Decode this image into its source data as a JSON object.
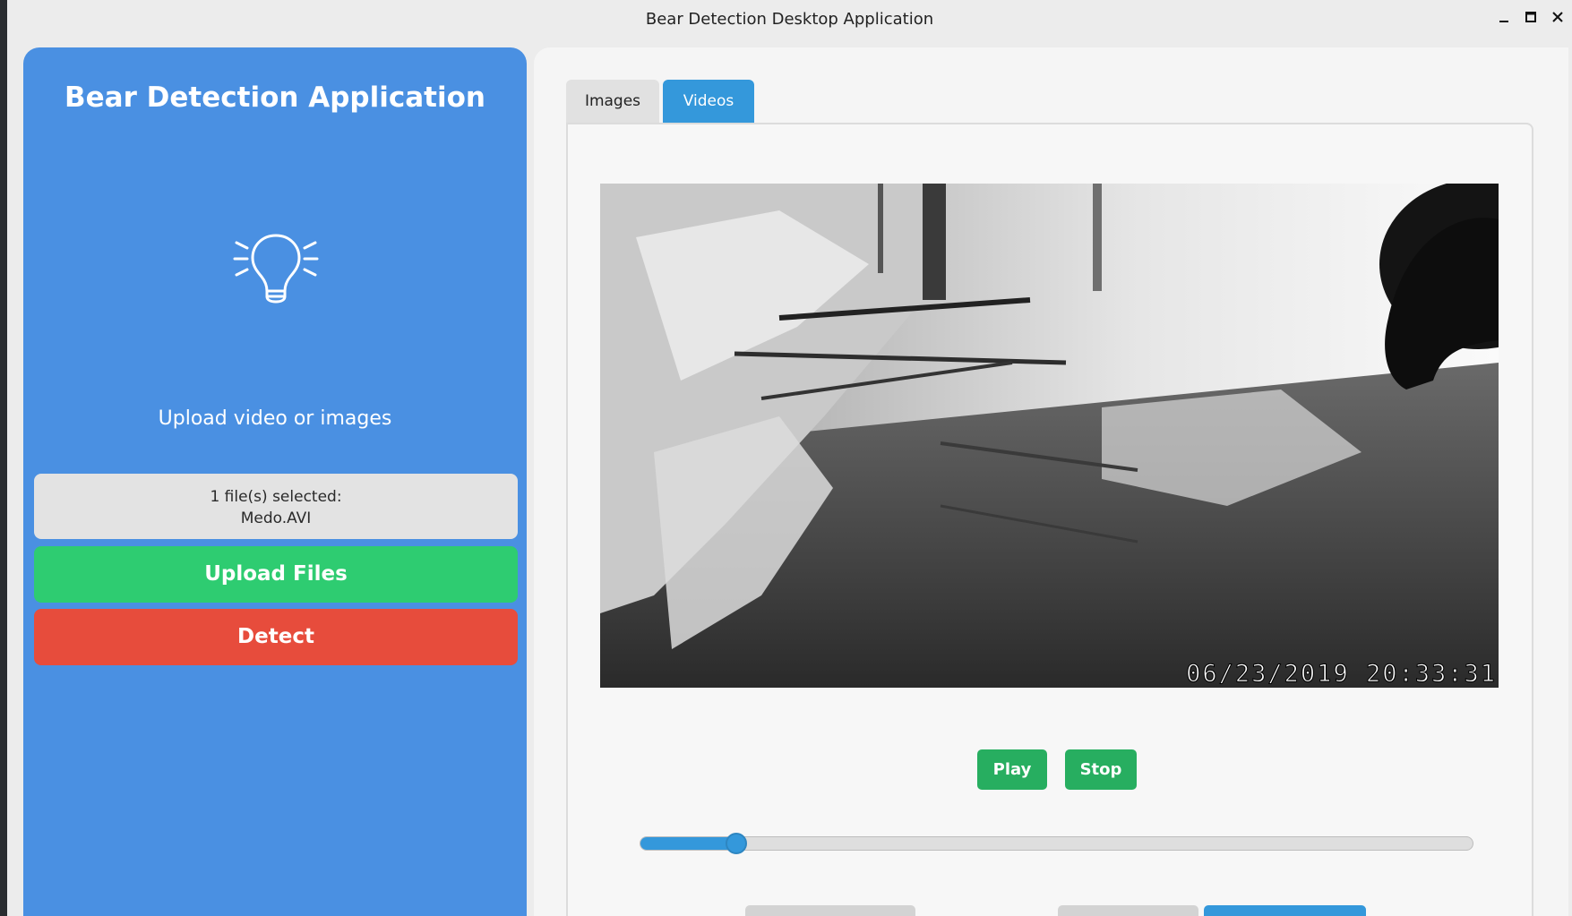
{
  "window": {
    "title": "Bear Detection Desktop Application"
  },
  "sidebar": {
    "title": "Bear Detection Application",
    "icon": "lightbulb-icon",
    "upload_hint": "Upload video or images",
    "file_status_line1": "1 file(s) selected:",
    "file_status_line2": "Medo.AVI",
    "upload_label": "Upload Files",
    "detect_label": "Detect"
  },
  "tabs": [
    {
      "label": "Images",
      "active": false
    },
    {
      "label": "Videos",
      "active": true
    }
  ],
  "video": {
    "timestamp": "06/23/2019   20:33:31",
    "play_label": "Play",
    "stop_label": "Stop",
    "progress": 0.116
  },
  "colors": {
    "sidebar": "#4a90e2",
    "upload": "#2ecc71",
    "detect": "#e74c3c",
    "accent": "#3498db",
    "play": "#27ae60"
  }
}
